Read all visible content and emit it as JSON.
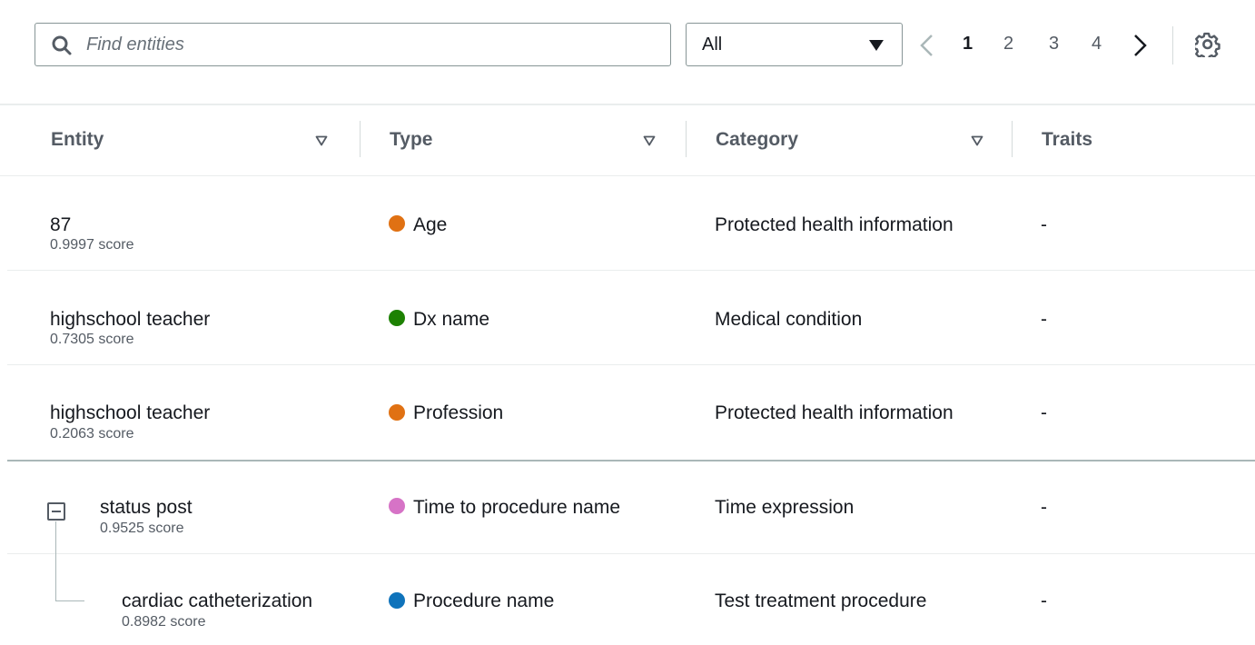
{
  "search": {
    "placeholder": "Find entities",
    "value": ""
  },
  "filter": {
    "selected": "All"
  },
  "pagination": {
    "pages": [
      "1",
      "2",
      "3",
      "4"
    ],
    "current": "1"
  },
  "columns": {
    "entity": "Entity",
    "type": "Type",
    "category": "Category",
    "traits": "Traits"
  },
  "colors": {
    "orange": "#e07113",
    "green": "#1d8102",
    "pink": "#d673c6",
    "blue": "#0f73bb"
  },
  "rows": [
    {
      "entity": "87",
      "score": "0.9997 score",
      "type": "Age",
      "type_color": "#e07113",
      "category": "Protected health information",
      "traits": "-"
    },
    {
      "entity": "highschool teacher",
      "score": "0.7305 score",
      "type": "Dx name",
      "type_color": "#1d8102",
      "category": "Medical condition",
      "traits": "-"
    },
    {
      "entity": "highschool teacher",
      "score": "0.2063 score",
      "type": "Profession",
      "type_color": "#e07113",
      "category": "Protected health information",
      "traits": "-"
    },
    {
      "entity": "status post",
      "score": "0.9525 score",
      "type": "Time to procedure name",
      "type_color": "#d673c6",
      "category": "Time expression",
      "traits": "-",
      "expanded": true
    },
    {
      "entity": "cardiac catheterization",
      "score": "0.8982 score",
      "type": "Procedure name",
      "type_color": "#0f73bb",
      "category": "Test treatment procedure",
      "traits": "-",
      "child_of": 3
    }
  ]
}
